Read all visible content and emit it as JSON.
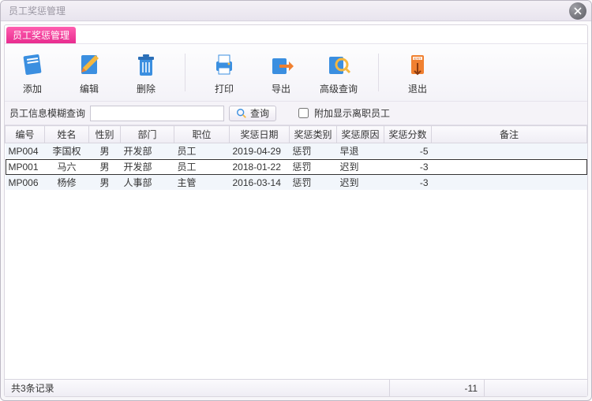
{
  "window": {
    "title": "员工奖惩管理"
  },
  "tab": {
    "label": "员工奖惩管理"
  },
  "toolbar": {
    "add": "添加",
    "edit": "编辑",
    "delete": "删除",
    "print": "打印",
    "export": "导出",
    "advanced_query": "高级查询",
    "exit": "退出"
  },
  "search": {
    "label": "员工信息模糊查询",
    "value": "",
    "placeholder": "",
    "query_btn": "查询",
    "show_left_label": "附加显示离职员工",
    "show_left_checked": false
  },
  "columns": [
    "编号",
    "姓名",
    "性别",
    "部门",
    "职位",
    "奖惩日期",
    "奖惩类别",
    "奖惩原因",
    "奖惩分数",
    "备注"
  ],
  "rows": [
    {
      "id": "MP004",
      "name": "李国权",
      "gender": "男",
      "dept": "开发部",
      "pos": "员工",
      "date": "2019-04-29",
      "type": "惩罚",
      "reason": "早退",
      "score": "-5",
      "remark": ""
    },
    {
      "id": "MP001",
      "name": "马六",
      "gender": "男",
      "dept": "开发部",
      "pos": "员工",
      "date": "2018-01-22",
      "type": "惩罚",
      "reason": "迟到",
      "score": "-3",
      "remark": ""
    },
    {
      "id": "MP006",
      "name": "杨修",
      "gender": "男",
      "dept": "人事部",
      "pos": "主管",
      "date": "2016-03-14",
      "type": "惩罚",
      "reason": "迟到",
      "score": "-3",
      "remark": ""
    }
  ],
  "selected_row": 1,
  "status": {
    "count_text": "共3条记录",
    "sum_text": "-11"
  }
}
